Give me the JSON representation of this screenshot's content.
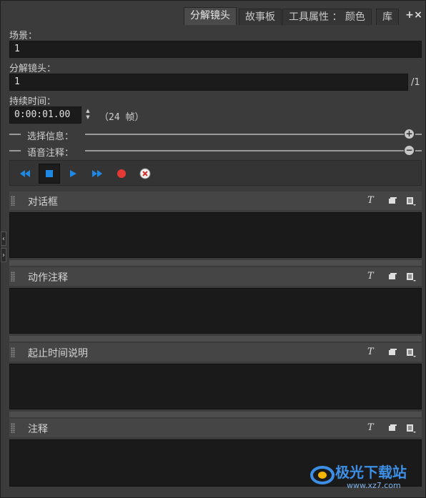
{
  "tabs": [
    {
      "label": "分解镜头",
      "active": true
    },
    {
      "label": "故事板",
      "active": false
    },
    {
      "label": "工具属性 ： 颜色",
      "active": false
    },
    {
      "label": "库",
      "active": false
    }
  ],
  "tab_icons": {
    "add": "+",
    "close": "×"
  },
  "scene": {
    "label": "场景：",
    "value": "1"
  },
  "breakdown": {
    "label": "分解镜头：",
    "value": "1",
    "suffix": "/1"
  },
  "duration": {
    "label": "持续时间：",
    "value": "0:00:01.00",
    "frames": "（24 帧）"
  },
  "selection_info": {
    "label": "选择信息：",
    "icon": "plus-circle-icon"
  },
  "voice_note": {
    "label": "语音注释：",
    "icon": "minus-circle-icon"
  },
  "transport": {
    "buttons": [
      "rewind-icon",
      "stop-icon",
      "play-icon",
      "fast-forward-icon",
      "record-icon",
      "delete-audio-icon"
    ],
    "colors": {
      "blue": "#1e88e5",
      "red": "#e53935"
    }
  },
  "panels": [
    {
      "title": "对话框"
    },
    {
      "title": "动作注释"
    },
    {
      "title": "起止时间说明"
    },
    {
      "title": "注释"
    }
  ],
  "panel_icons": {
    "text": "T"
  },
  "watermark": {
    "title": "极光下载站",
    "url": "www.xz7.com"
  }
}
